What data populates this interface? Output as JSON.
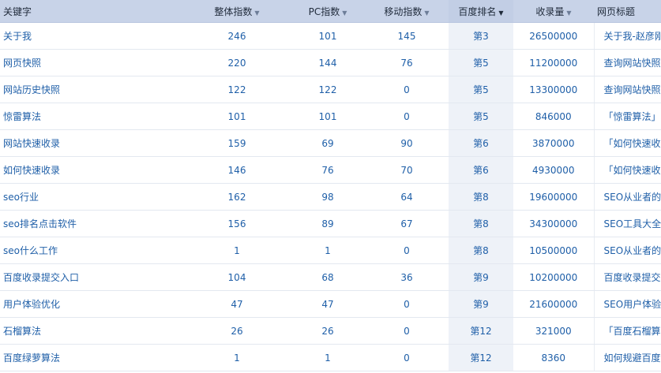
{
  "table": {
    "headers": [
      {
        "label": "关键字",
        "sortable": false
      },
      {
        "label": "整体指数",
        "sortable": true
      },
      {
        "label": "PC指数",
        "sortable": true
      },
      {
        "label": "移动指数",
        "sortable": true
      },
      {
        "label": "百度排名",
        "sortable": true,
        "active": true
      },
      {
        "label": "收录量",
        "sortable": true
      },
      {
        "label": "网页标题",
        "sortable": false
      }
    ],
    "sort_arrow": "▼",
    "rows": [
      {
        "keyword": "关于我",
        "overall": "246",
        "pc": "101",
        "mobile": "145",
        "rank": "第3",
        "indexed": "26500000",
        "title": "关于我-赵彦刚博客"
      },
      {
        "keyword": "网页快照",
        "overall": "220",
        "pc": "144",
        "mobile": "76",
        "rank": "第5",
        "indexed": "11200000",
        "title": "查询网站快照历史的几种方法"
      },
      {
        "keyword": "网站历史快照",
        "overall": "122",
        "pc": "122",
        "mobile": "0",
        "rank": "第5",
        "indexed": "13300000",
        "title": "查询网站快照历史的几种方法"
      },
      {
        "keyword": "惊雷算法",
        "overall": "101",
        "pc": "101",
        "mobile": "0",
        "rank": "第5",
        "indexed": "846000",
        "title": "「惊雷算法」百度惊雷算法"
      },
      {
        "keyword": "网站快速收录",
        "overall": "159",
        "pc": "69",
        "mobile": "90",
        "rank": "第6",
        "indexed": "3870000",
        "title": "「如何快速收录网站」让百度"
      },
      {
        "keyword": "如何快速收录",
        "overall": "146",
        "pc": "76",
        "mobile": "70",
        "rank": "第6",
        "indexed": "4930000",
        "title": "「如何快速收录网站」让百度"
      },
      {
        "keyword": "seo行业",
        "overall": "162",
        "pc": "98",
        "mobile": "64",
        "rank": "第8",
        "indexed": "19600000",
        "title": "SEO从业者的职业发展规划"
      },
      {
        "keyword": "seo排名点击软件",
        "overall": "156",
        "pc": "89",
        "mobile": "67",
        "rank": "第8",
        "indexed": "34300000",
        "title": "SEO工具大全-查权重、查收录"
      },
      {
        "keyword": "seo什么工作",
        "overall": "1",
        "pc": "1",
        "mobile": "0",
        "rank": "第8",
        "indexed": "10500000",
        "title": "SEO从业者的职业发展规划"
      },
      {
        "keyword": "百度收录提交入口",
        "overall": "104",
        "pc": "68",
        "mobile": "36",
        "rank": "第9",
        "indexed": "10200000",
        "title": "百度收录提交入口,最全的百度"
      },
      {
        "keyword": "用户体验优化",
        "overall": "47",
        "pc": "47",
        "mobile": "0",
        "rank": "第9",
        "indexed": "21600000",
        "title": "SEO用户体验、用户需求分析"
      },
      {
        "keyword": "石榴算法",
        "overall": "26",
        "pc": "26",
        "mobile": "0",
        "rank": "第12",
        "indexed": "321000",
        "title": "「百度石榴算法」石榴算法"
      },
      {
        "keyword": "百度绿萝算法",
        "overall": "1",
        "pc": "1",
        "mobile": "0",
        "rank": "第12",
        "indexed": "8360",
        "title": "如何规避百度绿萝算法的惩罚"
      }
    ]
  }
}
